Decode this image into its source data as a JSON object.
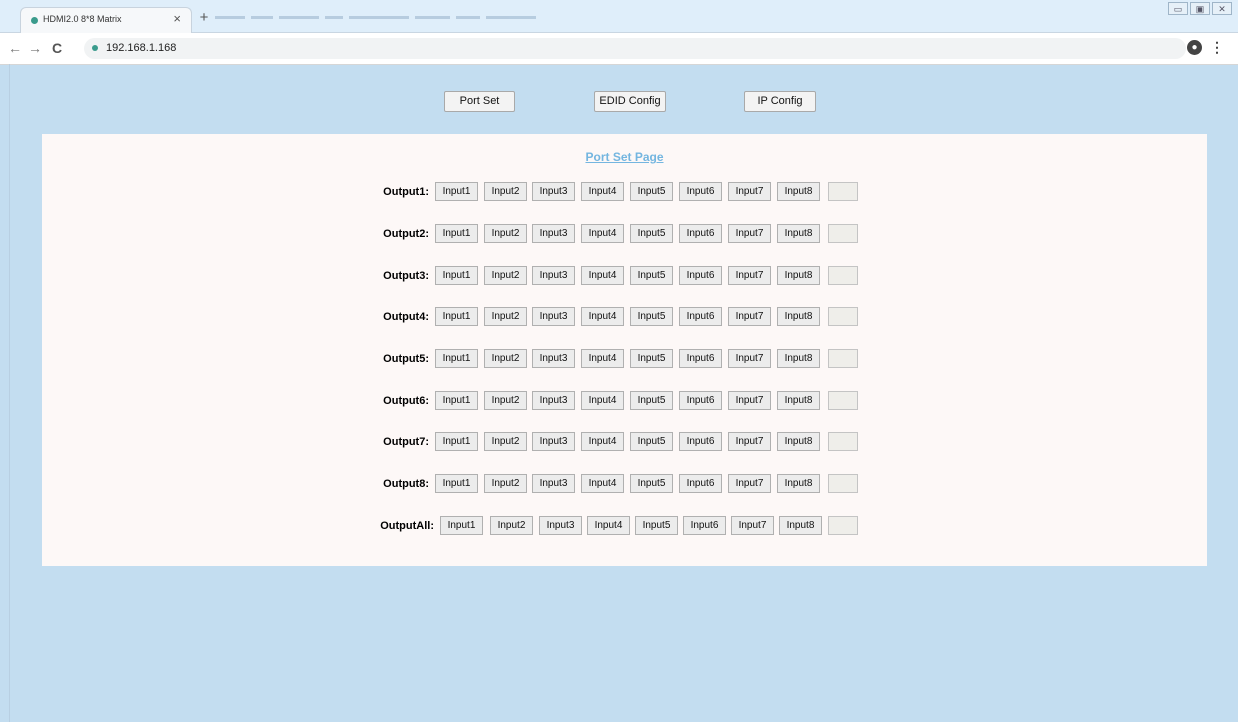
{
  "browser": {
    "tab_title": "HDMI2.0 8*8 Matrix",
    "tab_close": "×",
    "new_tab": "+",
    "url": "192.168.1.168",
    "back": "←",
    "forward": "→",
    "reload": "C",
    "window_controls": [
      "▭",
      "▣",
      "✕"
    ]
  },
  "nav": {
    "port_set": "Port Set",
    "edid_config": "EDID Config",
    "ip_config": "IP Config"
  },
  "page_title": "Port Set Page",
  "inputs": [
    "Input1",
    "Input2",
    "Input3",
    "Input4",
    "Input5",
    "Input6",
    "Input7",
    "Input8"
  ],
  "outputs": [
    {
      "label": "Output1:",
      "state": ""
    },
    {
      "label": "Output2:",
      "state": ""
    },
    {
      "label": "Output3:",
      "state": ""
    },
    {
      "label": "Output4:",
      "state": ""
    },
    {
      "label": "Output5:",
      "state": ""
    },
    {
      "label": "Output6:",
      "state": ""
    },
    {
      "label": "Output7:",
      "state": ""
    },
    {
      "label": "Output8:",
      "state": ""
    }
  ],
  "output_all": {
    "label": "OutputAll:",
    "state": ""
  }
}
